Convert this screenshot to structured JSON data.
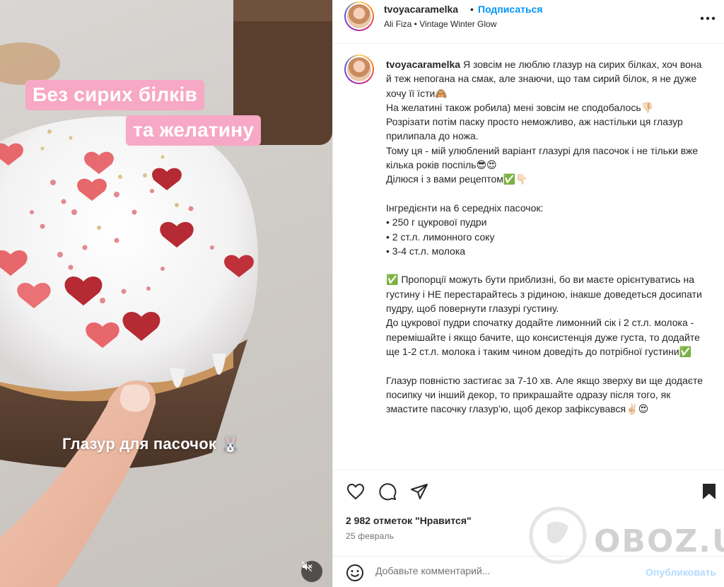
{
  "media": {
    "caption_top_1": "Без сирих білків",
    "caption_top_2": "та желатину",
    "caption_bottom": "Глазур для пасочок 🐰",
    "mute_icon": "speaker-muted-icon"
  },
  "header": {
    "username": "tvoyacaramelka",
    "separator": "•",
    "follow_label": "Подписаться",
    "audio_info": "Ali Fiza • Vintage Winter Glow",
    "more_icon": "more-icon"
  },
  "caption": {
    "username": "tvoyacaramelka",
    "lines": [
      "Я зовсім не люблю глазур на сирих білках, хоч вона й теж непогана на смак, але знаючи, що там сирий білок, я не дуже хочу її їсти🙈",
      "На желатині також робила) мені зовсім не сподобалось👎🏻",
      "Розрізати потім паску просто неможливо, аж настільки ця глазур прилипала до ножа.",
      "Тому ця - мій улюблений варіант глазурі для пасочок і не тільки вже кілька років поспіль😎😍",
      "Ділюся і з вами рецептом✅👇🏻",
      "",
      "Інгредієнти на 6 середніх пасочок:",
      "• 250 г цукрової пудри",
      "• 2 ст.л. лимонного соку",
      "• 3-4 ст.л. молока",
      "",
      "✅ Пропорції можуть бути приблизні, бо ви маєте орієнтуватись на густину і НЕ перестарайтесь з рідиною, інакше доведеться досипати пудру, щоб повернути глазурі густину.",
      "До цукрової пудри спочатку додайте лимонний сік і 2 ст.л. молока - перемішайте і якщо бачите, що консистенція дуже густа, то додайте ще 1-2 ст.л. молока і таким чином доведіть до потрібної густини✅",
      "",
      "Глазур повністю застигає за 7-10 хв. Але якщо зверху ви ще додаєте посипку чи інший декор, то прикрашайте одразу після того, як змастите пасочку глазур’ю, щоб декор зафіксувався✌🏻😍"
    ]
  },
  "actions": {
    "like_icon": "heart-icon",
    "comment_icon": "comment-icon",
    "share_icon": "share-icon",
    "save_icon": "bookmark-icon"
  },
  "stats": {
    "likes": "2 982 отметок \"Нравится\"",
    "date": "25 февраль"
  },
  "comment": {
    "emoji_icon": "emoji-icon",
    "placeholder": "Добавьте комментарий...",
    "publish_label": "Опубликовать"
  },
  "watermark": {
    "text": "OBOZ.UA"
  },
  "colors": {
    "accent": "#0095f6",
    "publish_disabled": "#b3dbff",
    "caption_bg": "#f7a8c4"
  }
}
